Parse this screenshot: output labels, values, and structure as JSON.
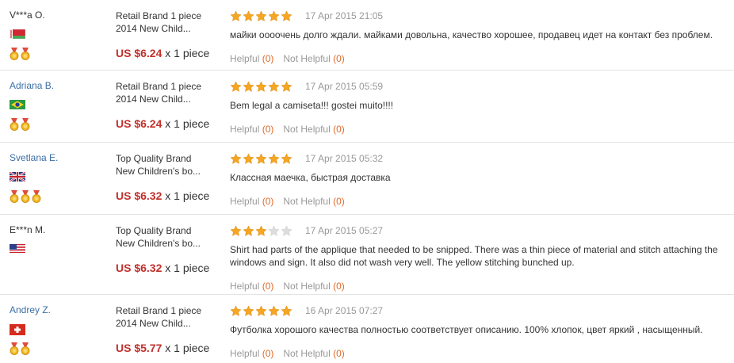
{
  "colors": {
    "username_link": "#3b6fa6",
    "price": "#c0302c",
    "star_on": "#f5a623",
    "star_off": "#dddddd",
    "date": "#999999",
    "count": "#e06b2a"
  },
  "reviews": [
    {
      "username": "V***a O.",
      "flag_icon": "belarus-flag-icon",
      "medals": 2,
      "product": [
        "Retail Brand 1 piece",
        "2014 New Child..."
      ],
      "price": "US $6.24",
      "quantity": "x 1 piece",
      "rating": 5,
      "date": "17 Apr 2015 21:05",
      "text": "майки оооочень долго ждали. майками довольна, качество хорошее, продавец идет на контакт без проблем.",
      "helpful_label": "Helpful",
      "helpful_count": "(0)",
      "not_helpful_label": "Not Helpful",
      "not_helpful_count": "(0)"
    },
    {
      "username": "Adriana B.",
      "flag_icon": "brazil-flag-icon",
      "medals": 2,
      "product": [
        "Retail Brand 1 piece",
        "2014 New Child..."
      ],
      "price": "US $6.24",
      "quantity": "x 1 piece",
      "rating": 5,
      "date": "17 Apr 2015 05:59",
      "text": "Bem legal a camiseta!!! gostei muito!!!!",
      "helpful_label": "Helpful",
      "helpful_count": "(0)",
      "not_helpful_label": "Not Helpful",
      "not_helpful_count": "(0)"
    },
    {
      "username": "Svetlana E.",
      "flag_icon": "uk-flag-icon",
      "medals": 3,
      "product": [
        "Top Quality Brand",
        "New Children's bo..."
      ],
      "price": "US $6.32",
      "quantity": "x 1 piece",
      "rating": 5,
      "date": "17 Apr 2015 05:32",
      "text": "Классная маечка, быстрая доставка",
      "helpful_label": "Helpful",
      "helpful_count": "(0)",
      "not_helpful_label": "Not Helpful",
      "not_helpful_count": "(0)"
    },
    {
      "username": "E***n M.",
      "flag_icon": "usa-flag-icon",
      "medals": 0,
      "product": [
        "Top Quality Brand",
        "New Children's bo..."
      ],
      "price": "US $6.32",
      "quantity": "x 1 piece",
      "rating": 3,
      "date": "17 Apr 2015 05:27",
      "text": "Shirt had parts of the applique that needed to be snipped. There was a thin piece of material and stitch attaching the windows and sign. It also did not wash very well. The yellow stitching bunched up.",
      "helpful_label": "Helpful",
      "helpful_count": "(0)",
      "not_helpful_label": "Not Helpful",
      "not_helpful_count": "(0)"
    },
    {
      "username": "Andrey Z.",
      "flag_icon": "switzerland-flag-icon",
      "medals": 2,
      "product": [
        "Retail Brand 1 piece",
        "2014 New Child..."
      ],
      "price": "US $5.77",
      "quantity": "x 1 piece",
      "rating": 5,
      "date": "16 Apr 2015 07:27",
      "text": "Футболка хорошого качества полностью соответствует описанию. 100% хлопок, цвет яркий , насыщенный.",
      "helpful_label": "Helpful",
      "helpful_count": "(0)",
      "not_helpful_label": "Not Helpful",
      "not_helpful_count": "(0)"
    }
  ]
}
